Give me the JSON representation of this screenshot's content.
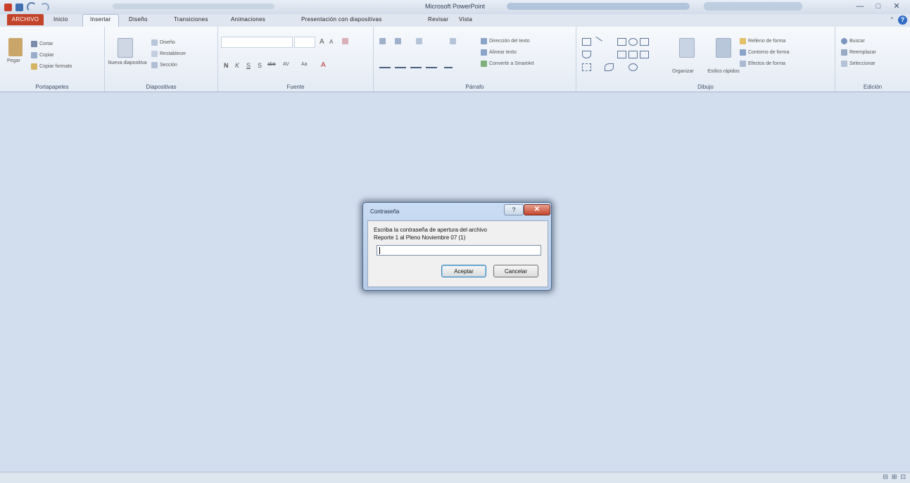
{
  "window": {
    "title": "Microsoft PowerPoint",
    "controls": [
      "—",
      "□",
      "✕"
    ]
  },
  "ribbon_tabs": [
    {
      "label": "ARCHIVO"
    },
    {
      "label": "Inicio"
    },
    {
      "label": "Insertar"
    },
    {
      "label": "Diseño"
    },
    {
      "label": "Transiciones"
    },
    {
      "label": "Animaciones"
    },
    {
      "label": "Presentación con diapositivas"
    },
    {
      "label": "Revisar"
    },
    {
      "label": "Vista"
    }
  ],
  "ribbon": {
    "portapapeles": {
      "label": "Portapapeles",
      "paste": "Pegar",
      "cut": "Cortar",
      "copy": "Copiar",
      "format_painter": "Copiar formato"
    },
    "diapositivas": {
      "label": "Diapositivas",
      "new_slide": "Nueva diapositiva",
      "layout": "Diseño",
      "reset": "Restablecer",
      "section": "Sección"
    },
    "fuente": {
      "label": "Fuente",
      "bold": "N",
      "italic": "K",
      "underline": "S",
      "strike": "S",
      "abc": "abe",
      "av": "AV",
      "aa": "Aa",
      "a": "A"
    },
    "parrafo": {
      "label": "Párrafo",
      "text_direction": "Dirección del texto",
      "align_text": "Alinear texto",
      "smartart": "Convertir a SmartArt"
    },
    "dibujo": {
      "label": "Dibujo",
      "arrange": "Organizar",
      "quick_styles": "Estilos rápidos",
      "fill": "Relleno de forma",
      "outline": "Contorno de forma",
      "effects": "Efectos de forma"
    },
    "edicion": {
      "label": "Edición",
      "find": "Buscar",
      "replace": "Reemplazar",
      "select": "Seleccionar"
    }
  },
  "dialog": {
    "title": "Contraseña",
    "help": "?",
    "close": "✕",
    "prompt_line1": "Escriba la contraseña de apertura del archivo",
    "prompt_line2": "Reporte 1 al Pleno Noviembre 07 (1)",
    "password_value": "",
    "accept": "Aceptar",
    "cancel": "Cancelar"
  },
  "statusbar": {
    "icons": [
      "⊟",
      "⊞",
      "⊡"
    ]
  }
}
